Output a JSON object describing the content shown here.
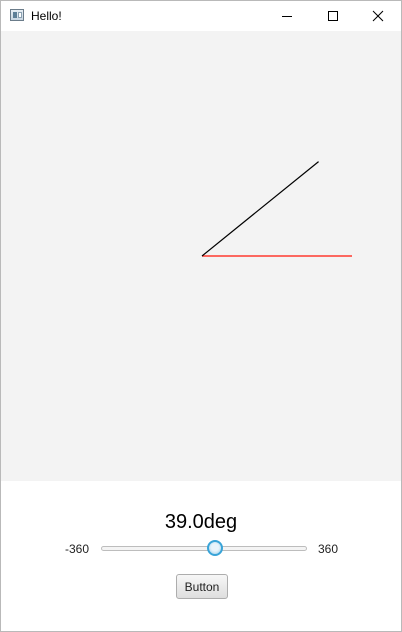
{
  "window": {
    "title": "Hello!",
    "app_icon": "java-app-icon",
    "controls": [
      "minimize-icon",
      "maximize-icon",
      "close-icon"
    ]
  },
  "canvas": {
    "background_color": "#f3f3f3",
    "angle_degrees": 39.0,
    "reference_line_color": "#ff3b30",
    "rotated_line_color": "#000000"
  },
  "controls": {
    "angle_text": "39.0deg",
    "slider": {
      "min_label": "-360",
      "max_label": "360",
      "min": -360,
      "max": 360,
      "value": 39.0,
      "accent_color": "#39a4d8"
    },
    "button_label": "Button"
  }
}
